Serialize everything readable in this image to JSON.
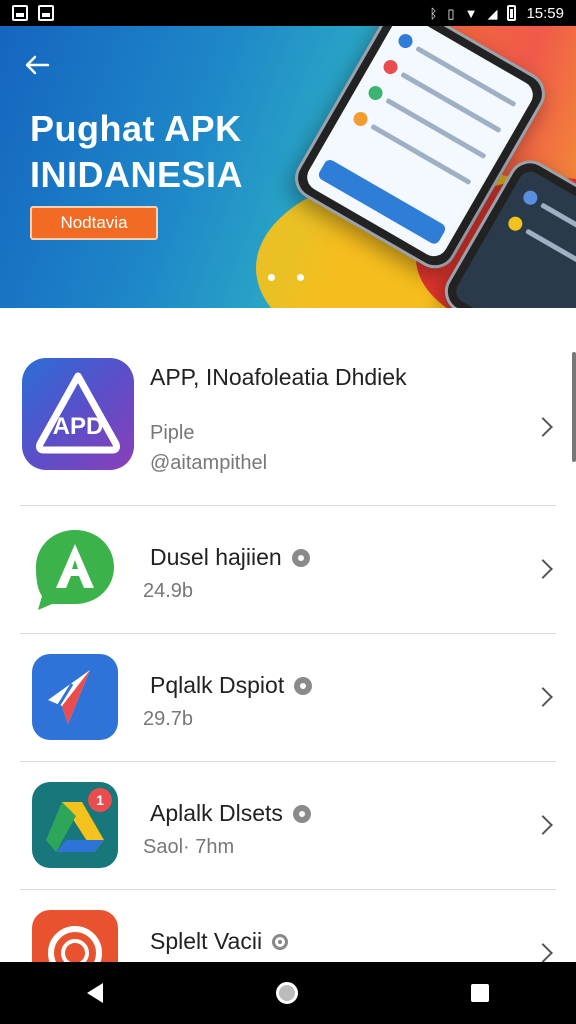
{
  "status_bar": {
    "time": "15:59",
    "left_icons": [
      "gallery-icon",
      "image-icon"
    ],
    "right_icons": [
      "bluetooth-icon",
      "vibrate-icon",
      "wifi-icon",
      "signal-icon",
      "battery-icon"
    ]
  },
  "banner": {
    "title": "Pughat APK INIDANESIA",
    "button_label": "Nodtavia",
    "page_dots": 2,
    "colors": {
      "blue": "#1565c0",
      "orange": "#f26b3a",
      "yellow": "#f4c21c"
    }
  },
  "featured_app": {
    "name": "APP, INoafoleatia Dhdiek",
    "line1": "Piple",
    "line2": "@aitampithel",
    "icon_text": "APD"
  },
  "apps": [
    {
      "name": "Dusel hajiien",
      "sub": "24.9b",
      "icon": "app-icon-green-a",
      "verified": true
    },
    {
      "name": "Pqlalk Dspiot",
      "sub": "29.7b",
      "icon": "app-icon-blue-compass",
      "verified": true
    },
    {
      "name": "Aplalk Dlsets",
      "sub": "Saol· 7hm",
      "icon": "app-icon-drive",
      "verified": true,
      "badge": "1"
    },
    {
      "name": "Splelt Vacii",
      "sub": "",
      "icon": "app-icon-orange",
      "verified": true
    }
  ],
  "nav_bar": {
    "buttons": [
      "back",
      "home",
      "recents"
    ]
  }
}
